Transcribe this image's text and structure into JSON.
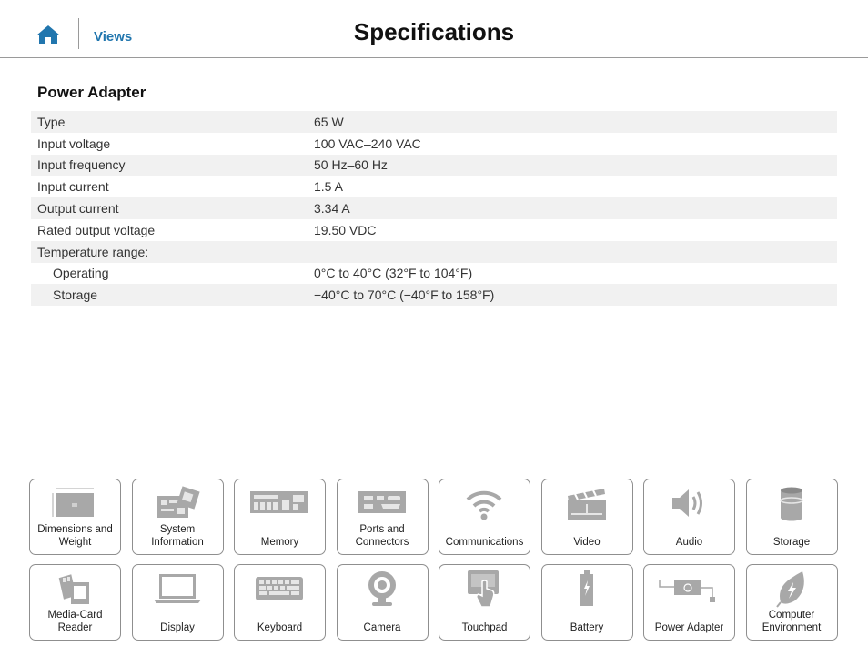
{
  "header": {
    "home_icon": "home-icon",
    "views_link": "Views",
    "title": "Specifications"
  },
  "section": {
    "title": "Power Adapter",
    "rows": [
      {
        "label": "Type",
        "value": "65 W"
      },
      {
        "label": "Input voltage",
        "value": "100 VAC–240 VAC"
      },
      {
        "label": "Input frequency",
        "value": "50 Hz–60 Hz"
      },
      {
        "label": "Input current",
        "value": "1.5 A"
      },
      {
        "label": "Output current",
        "value": "3.34 A"
      },
      {
        "label": "Rated output voltage",
        "value": "19.50 VDC"
      },
      {
        "label": "Temperature range:",
        "value": ""
      },
      {
        "label": "Operating",
        "value": "0°C to 40°C (32°F to 104°F)"
      },
      {
        "label": "Storage",
        "value": "−40°C to 70°C (−40°F to 158°F)"
      }
    ]
  },
  "nav_tiles": [
    {
      "label": "Dimensions and\nWeight",
      "icon": "laptop-dimensions-icon"
    },
    {
      "label": "System\nInformation",
      "icon": "motherboard-icon"
    },
    {
      "label": "Memory",
      "icon": "memory-module-icon"
    },
    {
      "label": "Ports and\nConnectors",
      "icon": "ports-icon"
    },
    {
      "label": "Communications",
      "icon": "wifi-icon"
    },
    {
      "label": "Video",
      "icon": "clapperboard-icon"
    },
    {
      "label": "Audio",
      "icon": "speaker-icon"
    },
    {
      "label": "Storage",
      "icon": "storage-drive-icon"
    },
    {
      "label": "Media-Card\nReader",
      "icon": "media-card-icon"
    },
    {
      "label": "Display",
      "icon": "display-laptop-icon"
    },
    {
      "label": "Keyboard",
      "icon": "keyboard-icon"
    },
    {
      "label": "Camera",
      "icon": "webcam-icon"
    },
    {
      "label": "Touchpad",
      "icon": "touchpad-icon"
    },
    {
      "label": "Battery",
      "icon": "battery-icon"
    },
    {
      "label": "Power Adapter",
      "icon": "power-adapter-icon"
    },
    {
      "label": "Computer\nEnvironment",
      "icon": "leaf-icon"
    }
  ],
  "colors": {
    "link": "#2176ae",
    "icon_gray": "#a8a8a8",
    "row_shade": "#f1f1f1",
    "tile_border": "#8f8f8f"
  }
}
